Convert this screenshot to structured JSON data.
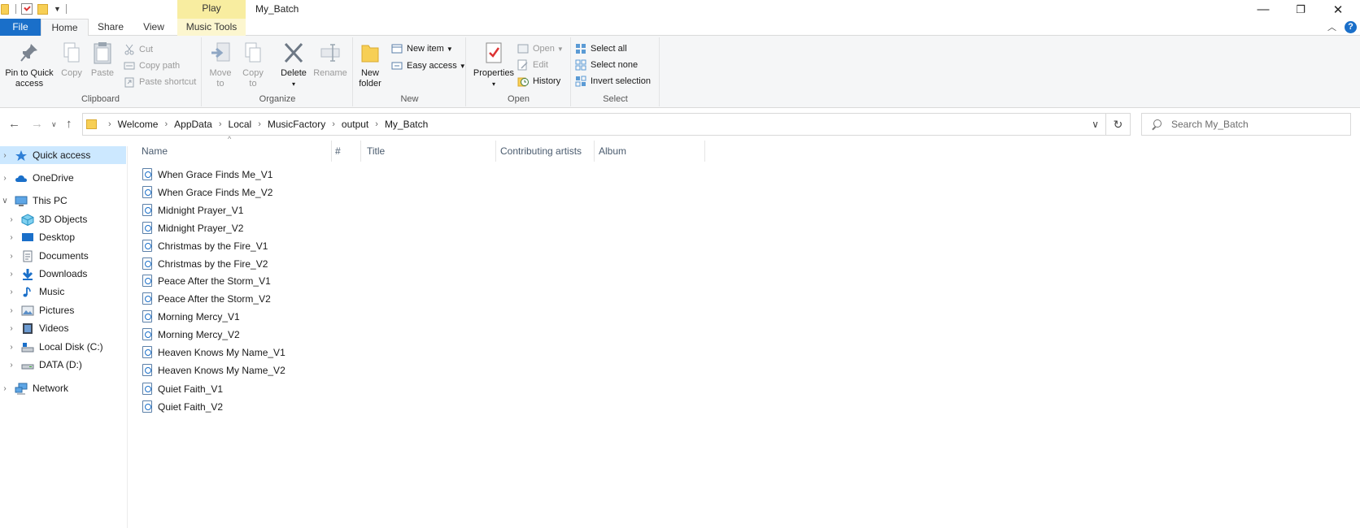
{
  "window": {
    "title": "My_Batch",
    "context_tab_header": "Play",
    "minimize_glyph": "—",
    "restore_glyph": "❐",
    "close_glyph": "✕"
  },
  "tabs": {
    "file": "File",
    "home": "Home",
    "share": "Share",
    "view": "View",
    "music_tools": "Music Tools",
    "help": "?"
  },
  "ribbon": {
    "clipboard": {
      "label": "Clipboard",
      "pin_line1": "Pin to Quick",
      "pin_line2": "access",
      "copy": "Copy",
      "paste": "Paste",
      "cut": "Cut",
      "copy_path": "Copy path",
      "paste_shortcut": "Paste shortcut"
    },
    "organize": {
      "label": "Organize",
      "move_to_line1": "Move",
      "move_to_line2": "to",
      "copy_to_line1": "Copy",
      "copy_to_line2": "to",
      "delete": "Delete",
      "rename": "Rename"
    },
    "new": {
      "label": "New",
      "new_folder_line1": "New",
      "new_folder_line2": "folder",
      "new_item": "New item",
      "easy_access": "Easy access"
    },
    "open": {
      "label": "Open",
      "properties": "Properties",
      "open": "Open",
      "edit": "Edit",
      "history": "History"
    },
    "select": {
      "label": "Select",
      "select_all": "Select all",
      "select_none": "Select none",
      "invert_selection": "Invert selection"
    }
  },
  "address": {
    "breadcrumbs": [
      "Welcome",
      "AppData",
      "Local",
      "MusicFactory",
      "output",
      "My_Batch"
    ],
    "search_placeholder": "Search My_Batch"
  },
  "nav": {
    "items": [
      {
        "label": "Quick access",
        "icon": "star-icon"
      },
      {
        "label": "OneDrive",
        "icon": "cloud-icon"
      },
      {
        "label": "This PC",
        "icon": "computer-icon"
      },
      {
        "label": "3D Objects",
        "icon": "cube-icon"
      },
      {
        "label": "Desktop",
        "icon": "desktop-icon"
      },
      {
        "label": "Documents",
        "icon": "document-icon"
      },
      {
        "label": "Downloads",
        "icon": "download-icon"
      },
      {
        "label": "Music",
        "icon": "music-note-icon"
      },
      {
        "label": "Pictures",
        "icon": "picture-icon"
      },
      {
        "label": "Videos",
        "icon": "video-icon"
      },
      {
        "label": "Local Disk (C:)",
        "icon": "drive-icon"
      },
      {
        "label": "DATA (D:)",
        "icon": "drive-icon"
      },
      {
        "label": "Network",
        "icon": "network-icon"
      }
    ]
  },
  "columns": {
    "name": "Name",
    "number": "#",
    "title": "Title",
    "contributing_artists": "Contributing artists",
    "album": "Album"
  },
  "files": [
    "When Grace Finds Me_V1",
    "When Grace Finds Me_V2",
    "Midnight Prayer_V1",
    "Midnight Prayer_V2",
    "Christmas by the Fire_V1",
    "Christmas by the Fire_V2",
    "Peace After the Storm_V1",
    "Peace After the Storm_V2",
    "Morning Mercy_V1",
    "Morning Mercy_V2",
    "Heaven Knows My Name_V1",
    "Heaven Knows My Name_V2",
    "Quiet Faith_V1",
    "Quiet Faith_V2"
  ],
  "colors": {
    "accent": "#1a6fc9",
    "context_tab": "#f8eda0",
    "selection": "#cce8ff"
  }
}
